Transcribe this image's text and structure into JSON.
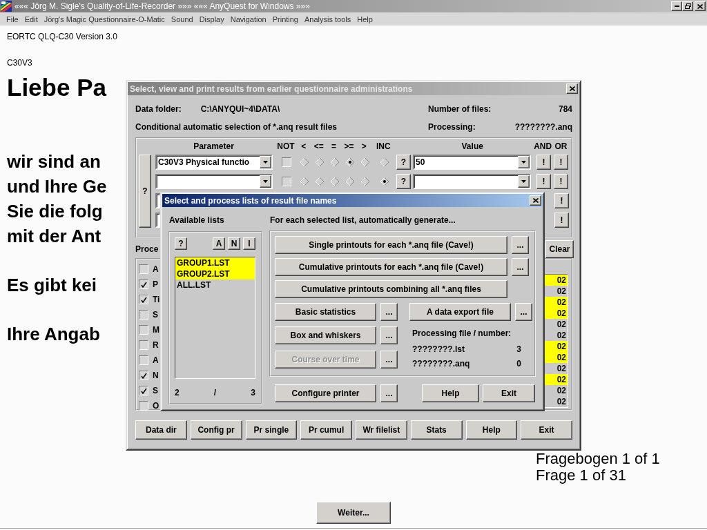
{
  "window": {
    "title": "««« Jörg M. Sigle's Quality-of-Life-Recorder »»» ««« AnyQuest for Windows »»»"
  },
  "menu": [
    "File",
    "Edit",
    "Jörg's Magic Questionnaire-O-Matic",
    "Sound",
    "Display",
    "Navigation",
    "Printing",
    "Analysis tools",
    "Help"
  ],
  "questionnaire": {
    "name": "EORTC QLQ-C30 Version 3.0",
    "code": "C30V3",
    "greeting": "Liebe Pa",
    "paragraphs": [
      [
        "wir sind an",
        "und Ihre Ge",
        "Sie die folg",
        "mit der Ant"
      ],
      [
        "Es gibt kei"
      ],
      [
        "Ihre Angab"
      ]
    ],
    "form_counter": "Fragebogen 1 of 1",
    "question_counter": "Frage 1 of 31",
    "next_button": "Weiter..."
  },
  "results": {
    "title": "Select, view and print results from earlier questionnaire administrations",
    "data_folder_label": "Data folder:",
    "data_folder": "C:\\ANYQUI~4\\DATA\\",
    "files_label": "Number of files:",
    "files": "784",
    "selection_label": "Conditional automatic selection of *.anq result files",
    "processing_label": "Processing:",
    "processing": "????????.anq",
    "columns": [
      "Parameter",
      "NOT",
      "<",
      "<=",
      "=",
      ">=",
      ">",
      "INC",
      "Value",
      "AND",
      "OR"
    ],
    "help_button": "?",
    "conditions": [
      {
        "kind": "full",
        "parameter": "C30V3 Physical functio",
        "not": false,
        "operators": [
          {
            "selected": false
          },
          {
            "selected": false
          },
          {
            "selected": false
          },
          {
            "selected": true
          },
          {
            "selected": false
          },
          {
            "selected": false
          }
        ],
        "help": "?",
        "value": "50",
        "and": "!",
        "or": "!"
      },
      {
        "kind": "full",
        "not": false,
        "operators": [
          {
            "selected": false
          },
          {
            "selected": false
          },
          {
            "selected": false
          },
          {
            "selected": false
          },
          {
            "selected": false
          },
          {
            "selected": true
          }
        ],
        "help": "?",
        "and": "!",
        "or": "!"
      },
      {
        "kind": "covered",
        "or": "!"
      },
      {
        "kind": "covered",
        "or": "!"
      }
    ],
    "process_label": "Proce",
    "clear_button": "Clear",
    "options": [
      {
        "label": "A",
        "checked": false
      },
      {
        "label": "P",
        "checked": true
      },
      {
        "label": "Ti",
        "checked": true
      },
      {
        "label": "S",
        "checked": false
      },
      {
        "label": "M",
        "checked": false
      },
      {
        "label": "R",
        "checked": false
      },
      {
        "label": "A",
        "checked": false
      },
      {
        "label": "N",
        "checked": true
      },
      {
        "label": "S",
        "checked": true
      },
      {
        "label": "O",
        "checked": false
      }
    ],
    "files_list": [
      {
        "text": "02",
        "selected": true
      },
      {
        "text": "02",
        "selected": false
      },
      {
        "text": "02",
        "selected": true
      },
      {
        "text": "02",
        "selected": true
      },
      {
        "text": "02",
        "selected": false
      },
      {
        "text": "02",
        "selected": false
      },
      {
        "text": "02",
        "selected": true
      },
      {
        "text": "02",
        "selected": true
      },
      {
        "text": "02",
        "selected": false
      },
      {
        "text": "02",
        "selected": true
      },
      {
        "text": "02",
        "selected": false
      },
      {
        "text": "02",
        "selected": false
      }
    ],
    "buttons": [
      "Data dir",
      "Config pr",
      "Pr single",
      "Pr cumul",
      "Wr filelist",
      "Stats",
      "Help",
      "Exit"
    ]
  },
  "lists_dialog": {
    "title": "Select and process lists of result file names",
    "lists_label": "Available lists",
    "help_button": "?",
    "sort_buttons": [
      "A",
      "N",
      "I"
    ],
    "lists": [
      {
        "name": "GROUP1.LST",
        "selected": true
      },
      {
        "name": "GROUP2.LST",
        "selected": true
      },
      {
        "name": "ALL.LST",
        "selected": false
      }
    ],
    "selected_count": "2",
    "separator": "/",
    "total_count": "3",
    "generate_label": "For each selected list, automatically generate...",
    "wide_actions": [
      {
        "label": "Single printouts for each *.anq file (Cave!)",
        "options": "..."
      },
      {
        "label": "Cumulative printouts for each *.anq file (Cave!)",
        "options": "..."
      },
      {
        "label": "Cumulative printouts combining all *.anq files"
      }
    ],
    "statistics_action": {
      "label": "Basic statistics",
      "options": "..."
    },
    "export_action": {
      "label": "A data export file",
      "options": "..."
    },
    "chart_actions": [
      {
        "label": "Box and whiskers",
        "disabled": false,
        "options": "..."
      },
      {
        "label": "Course over time",
        "disabled": true,
        "options": "..."
      }
    ],
    "status_label": "Processing file / number:",
    "status": [
      {
        "file": "????????.lst",
        "number": "3"
      },
      {
        "file": "????????.anq",
        "number": "0"
      }
    ],
    "printer_button": "Configure printer",
    "printer_options": "...",
    "help_button_2": "Help",
    "exit_button": "Exit"
  }
}
